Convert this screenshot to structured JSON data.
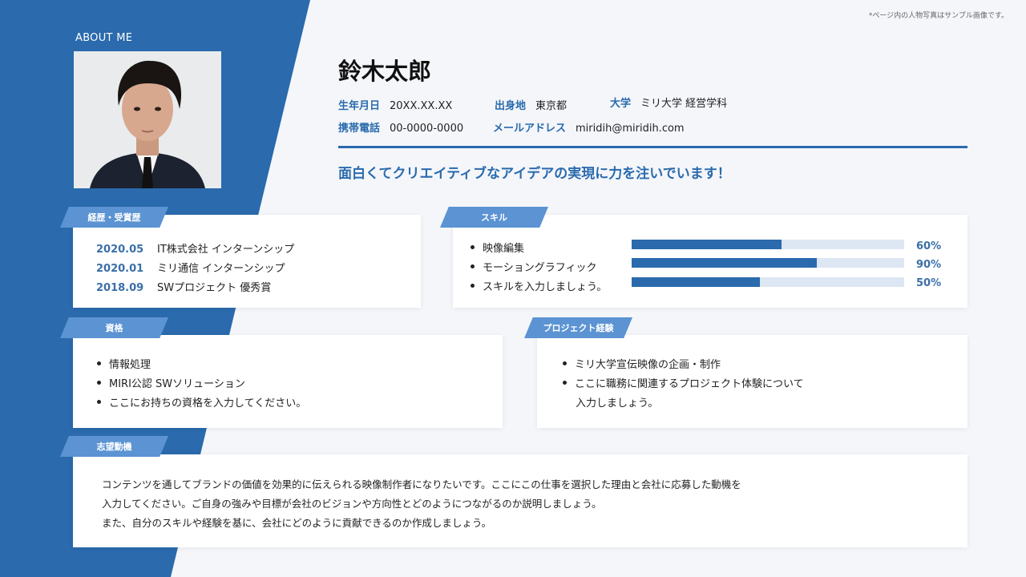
{
  "note": "*ページ内の人物写真はサンプル画像です。",
  "about_label": "ABOUT ME",
  "name": "鈴木太郎",
  "info": {
    "birth": {
      "label": "生年月日",
      "value": "20XX.XX.XX"
    },
    "origin": {
      "label": "出身地",
      "value": "東京都"
    },
    "university": {
      "label": "大学",
      "value": "ミリ大学 経営学科"
    },
    "phone": {
      "label": "携帯電話",
      "value": "00-0000-0000"
    },
    "email": {
      "label": "メールアドレス",
      "value": "miridih@miridih.com"
    }
  },
  "tagline": "面白くてクリエイティブなアイデアの実現に力を注いでいます！",
  "career": {
    "title": "経歴・受賞歴",
    "items": [
      {
        "date": "2020.05",
        "text": "IT株式会社 インターンシップ"
      },
      {
        "date": "2020.01",
        "text": "ミリ通信 インターンシップ"
      },
      {
        "date": "2018.09",
        "text": "SWプロジェクト 優秀賞"
      }
    ]
  },
  "skills": {
    "title": "スキル",
    "items": [
      {
        "name": "映像編集",
        "level": 0.55,
        "label": "60%"
      },
      {
        "name": "モーショングラフィック",
        "level": 0.68,
        "label": "90%"
      },
      {
        "name": "スキルを入力しましょう。",
        "level": 0.47,
        "label": "50%"
      }
    ]
  },
  "qualifications": {
    "title": "資格",
    "items": [
      "情報処理",
      "MIRI公認 SWソリューション",
      "ここにお持ちの資格を入力してください。"
    ]
  },
  "projects": {
    "title": "プロジェクト経験",
    "items": [
      "ミリ大学宣伝映像の企画・制作",
      "ここに職務に関連するプロジェクト体験について",
      "入力しましょう。"
    ]
  },
  "motivation": {
    "title": "志望動機",
    "lines": [
      "コンテンツを通してブランドの価値を効果的に伝えられる映像制作者になりたいです。ここにこの仕事を選択した理由と会社に応募した動機を",
      "入力してください。ご自身の強みや目標が会社のビジョンや方向性とどのようにつながるのか説明しましょう。",
      "また、自分のスキルや経験を基に、会社にどのように貢献できるのか作成しましょう。"
    ]
  },
  "colors": {
    "primary": "#2a6aad",
    "tag": "#5b93d3",
    "background": "#f4f6fa"
  }
}
